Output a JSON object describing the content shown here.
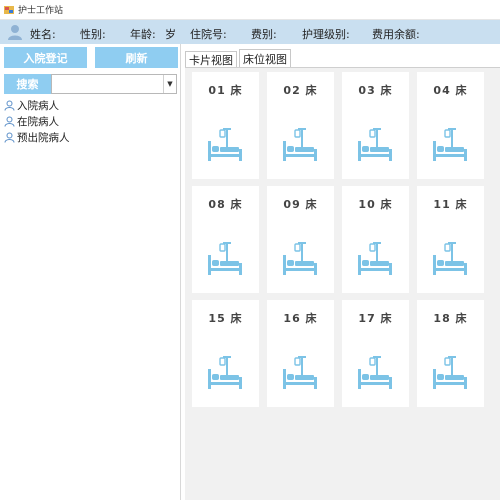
{
  "window": {
    "title": "护士工作站"
  },
  "patient_info": {
    "name_label": "姓名:",
    "gender_label": "性别:",
    "age_label": "年龄:",
    "age_unit": "岁",
    "admission_no_label": "住院号:",
    "fee_type_label": "费别:",
    "care_level_label": "护理级别:",
    "balance_label": "费用余额:"
  },
  "left_panel": {
    "admit_button": "入院登记",
    "refresh_button": "刷新",
    "search_button": "搜索",
    "search_value": "",
    "tree": [
      {
        "label": "入院病人"
      },
      {
        "label": "在院病人"
      },
      {
        "label": "预出院病人"
      }
    ]
  },
  "tabs": [
    {
      "label": "卡片视图",
      "active": false
    },
    {
      "label": "床位视图",
      "active": true
    }
  ],
  "beds": [
    {
      "label": "01 床"
    },
    {
      "label": "02 床"
    },
    {
      "label": "03 床"
    },
    {
      "label": "04 床"
    },
    {
      "label": "08 床"
    },
    {
      "label": "09 床"
    },
    {
      "label": "10 床"
    },
    {
      "label": "11 床"
    },
    {
      "label": "15 床"
    },
    {
      "label": "16 床"
    },
    {
      "label": "17 床"
    },
    {
      "label": "18 床"
    }
  ],
  "colors": {
    "accent": "#8fcdf1",
    "header_bg": "#c9dff0",
    "bed_icon": "#7cc3e6",
    "content_bg": "#f1f1f1"
  }
}
